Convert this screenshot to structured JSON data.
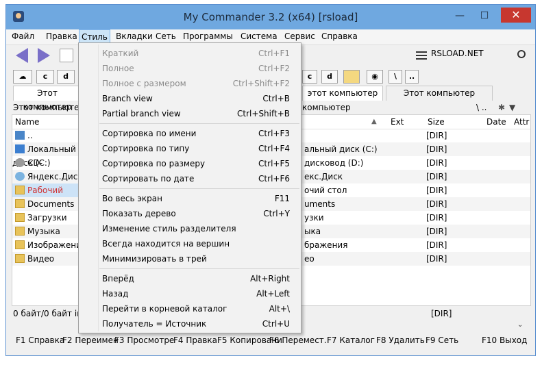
{
  "window": {
    "title": "My Commander 3.2 (x64) [rsload]",
    "minimize": "—",
    "maximize": "☐",
    "close": "✕"
  },
  "menubar": [
    "Файл",
    "Правка",
    "Стиль",
    "Вкладки",
    "Сеть",
    "Программы",
    "Система",
    "Сервис",
    "Справка"
  ],
  "toolbar": {
    "site": "RSLOAD.NET"
  },
  "drives": {
    "left": [
      "c",
      "d"
    ],
    "right": [
      "c",
      "d"
    ],
    "backslash": "\\",
    "dots": ".."
  },
  "tabs": {
    "left": "Этот компьютер",
    "right_1": "этот компьютер",
    "right_2": "Этот компьютер"
  },
  "left_panel": {
    "path": "Этот компьютер",
    "header_name": "Name",
    "rows": [
      {
        "name": ".."
      },
      {
        "name": "Локальный диск (C:)"
      },
      {
        "name": "CD-дисковод (D:)"
      },
      {
        "name": "Яндекс.Диск"
      },
      {
        "name": "Рабочий стол"
      },
      {
        "name": "Documents"
      },
      {
        "name": "Загрузки"
      },
      {
        "name": "Музыка"
      },
      {
        "name": "Изображения"
      },
      {
        "name": "Видео"
      }
    ],
    "status": "0 байт/0 байт in 0"
  },
  "right_panel": {
    "path": "компьютер",
    "path_tools": "\\ ..",
    "headers": {
      "ext": "Ext",
      "size": "Size",
      "date": "Date",
      "attr": "Attr"
    },
    "rows": [
      {
        "name": "",
        "size": "[DIR]"
      },
      {
        "name": "альный диск (C:)",
        "size": "[DIR]"
      },
      {
        "name": "дисковод (D:)",
        "size": "[DIR]"
      },
      {
        "name": "екс.Диск",
        "size": "[DIR]"
      },
      {
        "name": "очий стол",
        "size": "[DIR]"
      },
      {
        "name": "uments",
        "size": "[DIR]"
      },
      {
        "name": "узки",
        "size": "[DIR]"
      },
      {
        "name": "ыка",
        "size": "[DIR]"
      },
      {
        "name": "бражения",
        "size": "[DIR]"
      },
      {
        "name": "ео",
        "size": "[DIR]"
      }
    ],
    "status_dir": "[DIR]"
  },
  "fkeys": [
    "F1 Справка",
    "F2 Переимен",
    "F3 Просмотре",
    "F4 Правка",
    "F5 Копировани",
    "F6 Перемест.",
    "F7 Каталог",
    "F8 Удалить",
    "F9 Сеть",
    "F10 Выход"
  ],
  "style_menu": {
    "items": [
      {
        "label": "Краткий",
        "shortcut": "Ctrl+F1",
        "disabled": true
      },
      {
        "label": "Полное",
        "shortcut": "Ctrl+F2",
        "disabled": true
      },
      {
        "label": "Полное с размером",
        "shortcut": "Ctrl+Shift+F2",
        "disabled": true
      },
      {
        "label": "Branch view",
        "shortcut": "Ctrl+B"
      },
      {
        "label": "Partial branch view",
        "shortcut": "Ctrl+Shift+B"
      },
      {
        "label": "Сортировка по имени",
        "shortcut": "Ctrl+F3"
      },
      {
        "label": "Сортировка по типу",
        "shortcut": "Ctrl+F4"
      },
      {
        "label": "Сортировка по размеру",
        "shortcut": "Ctrl+F5"
      },
      {
        "label": "Сортировать по дате",
        "shortcut": "Ctrl+F6"
      },
      {
        "label": "Во весь экран",
        "shortcut": "F11"
      },
      {
        "label": "Показать дерево",
        "shortcut": "Ctrl+Y"
      },
      {
        "label": "Изменение стиль разделителя",
        "shortcut": ""
      },
      {
        "label": "Всегда находится на вершин",
        "shortcut": ""
      },
      {
        "label": "Минимизировать в трей",
        "shortcut": ""
      },
      {
        "label": "Вперёд",
        "shortcut": "Alt+Right"
      },
      {
        "label": "Назад",
        "shortcut": "Alt+Left"
      },
      {
        "label": "Перейти в корневой каталог",
        "shortcut": "Alt+\\"
      },
      {
        "label": "Получатель = Источник",
        "shortcut": "Ctrl+U"
      }
    ]
  },
  "colors": {
    "titlebar": "#6fa8e0",
    "close": "#c7372f",
    "menu_highlight": "#cce4f7",
    "selected_text": "#d03030"
  }
}
